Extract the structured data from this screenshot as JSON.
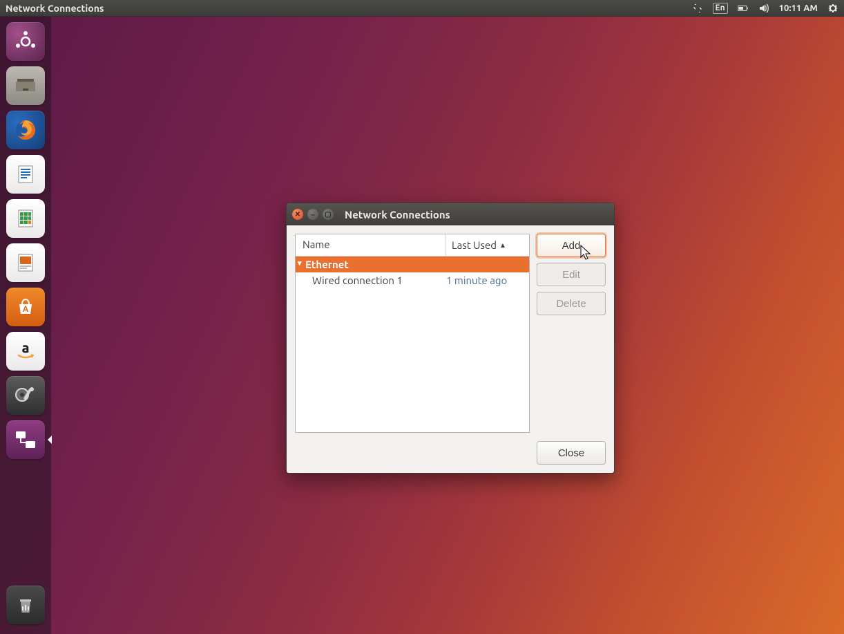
{
  "menubar": {
    "title": "Network Connections",
    "language": "En",
    "time": "10:11 AM"
  },
  "launcher": {
    "items": [
      {
        "name": "dash"
      },
      {
        "name": "files"
      },
      {
        "name": "firefox"
      },
      {
        "name": "writer"
      },
      {
        "name": "calc"
      },
      {
        "name": "impress"
      },
      {
        "name": "software"
      },
      {
        "name": "amazon"
      },
      {
        "name": "settings"
      },
      {
        "name": "network",
        "active": true
      }
    ],
    "trash": {
      "name": "trash"
    }
  },
  "dialog": {
    "title": "Network Connections",
    "columns": {
      "name": "Name",
      "last_used": "Last Used"
    },
    "group": "Ethernet",
    "connection": {
      "name": "Wired connection 1",
      "last_used": "1 minute ago"
    },
    "buttons": {
      "add": "Add",
      "edit": "Edit",
      "delete": "Delete",
      "close": "Close"
    }
  }
}
